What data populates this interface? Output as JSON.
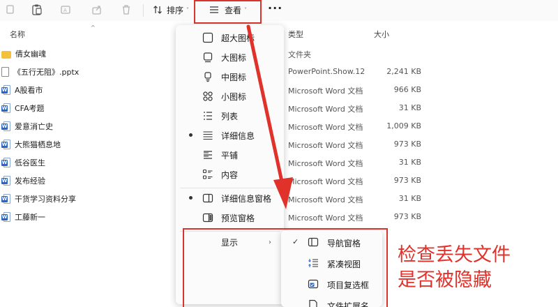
{
  "toolbar": {
    "sort_label": "排序",
    "view_label": "查看",
    "more_label": "···",
    "chevron": "˅"
  },
  "columns": {
    "name": "名称",
    "type": "类型",
    "size": "大小",
    "sort_indicator": "^"
  },
  "files": [
    {
      "name": "倩女幽魂",
      "icon": "folder-icon",
      "type": "文件夹",
      "size": ""
    },
    {
      "name": "《五行无阻》.pptx",
      "icon": "document-icon",
      "type": "PowerPoint.Show.12",
      "size": "2,241 KB"
    },
    {
      "name": "A股看市",
      "icon": "word-icon",
      "type": "Microsoft Word 文档",
      "size": "966 KB"
    },
    {
      "name": "CFA考题",
      "icon": "word-icon",
      "type": "Microsoft Word 文档",
      "size": "31 KB"
    },
    {
      "name": "爱意消亡史",
      "icon": "word-icon",
      "type": "Microsoft Word 文档",
      "size": "1,009 KB"
    },
    {
      "name": "大熊猫栖息地",
      "icon": "word-icon",
      "type": "Microsoft Word 文档",
      "size": "973 KB"
    },
    {
      "name": "低谷医生",
      "icon": "word-icon",
      "type": "Microsoft Word 文档",
      "size": "31 KB"
    },
    {
      "name": "发布经验",
      "icon": "word-icon",
      "type": "Microsoft Word 文档",
      "size": "973 KB"
    },
    {
      "name": "干货学习资料分享",
      "icon": "word-icon",
      "type": "Microsoft Word 文档",
      "size": "31 KB"
    },
    {
      "name": "工藤新一",
      "icon": "word-icon",
      "type": "Microsoft Word 文档",
      "size": "973 KB"
    }
  ],
  "view_menu": {
    "items": [
      {
        "label": "超大图标",
        "icon": "extra-large-icons-icon",
        "selected": false
      },
      {
        "label": "大图标",
        "icon": "large-icons-icon",
        "selected": false
      },
      {
        "label": "中图标",
        "icon": "medium-icons-icon",
        "selected": false
      },
      {
        "label": "小图标",
        "icon": "small-icons-icon",
        "selected": false
      },
      {
        "label": "列表",
        "icon": "list-icon",
        "selected": false
      },
      {
        "label": "详细信息",
        "icon": "details-icon",
        "selected": true
      },
      {
        "label": "平铺",
        "icon": "tiles-icon",
        "selected": false
      },
      {
        "label": "内容",
        "icon": "content-icon",
        "selected": false
      }
    ],
    "panes": [
      {
        "label": "详细信息窗格",
        "icon": "details-pane-icon",
        "selected": true
      },
      {
        "label": "预览窗格",
        "icon": "preview-pane-icon",
        "selected": false
      }
    ],
    "show_label": "显示",
    "show_arrow": "›"
  },
  "show_submenu": {
    "items": [
      {
        "label": "导航窗格",
        "icon": "navigation-pane-icon",
        "checked": true
      },
      {
        "label": "紧凑视图",
        "icon": "compact-view-icon",
        "checked": false
      },
      {
        "label": "项目复选框",
        "icon": "item-checkbox-icon",
        "checked": false
      },
      {
        "label": "文件扩展名",
        "icon": "file-extension-icon",
        "checked": false
      }
    ],
    "check_mark": "✓"
  },
  "annotation": {
    "line1": "检查丢失文件",
    "line2": "是否被隐藏"
  },
  "colors": {
    "highlight_red": "#d9332b",
    "annotation_red": "#e0312a",
    "folder_yellow": "#f4c13d",
    "word_blue": "#2b66c4"
  }
}
